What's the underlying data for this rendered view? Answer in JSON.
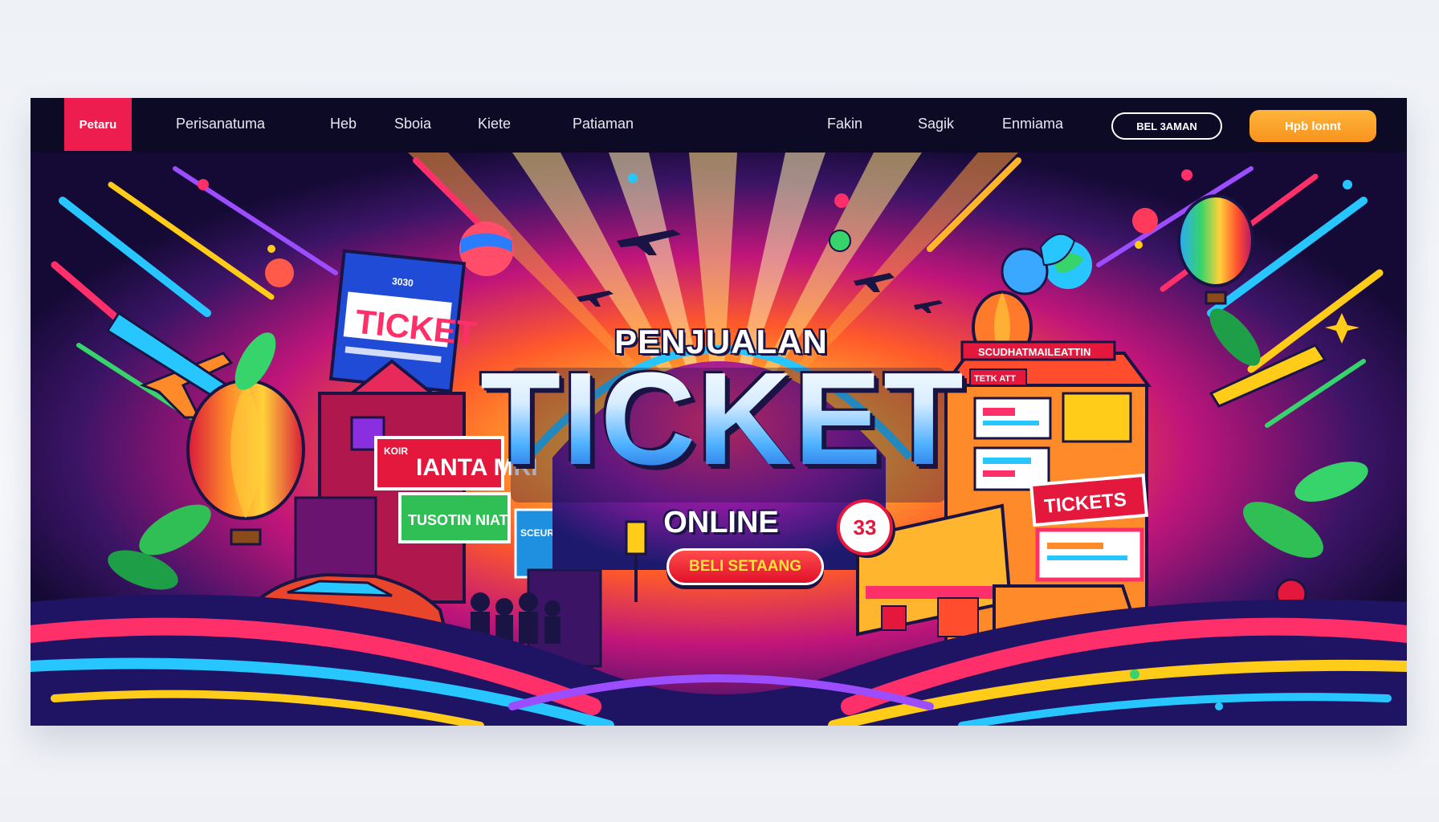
{
  "brand": {
    "logo_text": "Petaru"
  },
  "nav": {
    "items": [
      "Perisanatuma",
      "Heb",
      "Sboia",
      "Kiete",
      "Patiaman",
      "Fakin",
      "Sagik",
      "Enmiama"
    ],
    "outline_button": "BEL 3AMAN",
    "primary_button": "Hpb lonnt"
  },
  "hero": {
    "pre_title": "PENJUALAN",
    "title": "TICKET",
    "subtitle": "ONLINE",
    "badge": "33",
    "cta": "BELI SETAANG",
    "signs": {
      "left_billboard": "TICKET",
      "left_billboard_small": "3030",
      "left_red_sign": "IANTA MRI",
      "left_red_sign_small": "KOIR",
      "left_green_sign": "TUSOTIN NIAT",
      "left_blue_sign": "SCEURIN",
      "right_building_top": "SCUDHATMAILEATTIN",
      "right_building_top_left": "TETK ATT",
      "right_tickets_sign": "TICKETS"
    }
  },
  "colors": {
    "frame_bg": "#120a2e",
    "navbar_bg": "#0d0a26",
    "logo_bg": "#ee1d4f",
    "primary_button": "#f7931e",
    "cta_red": "#e0112b",
    "cta_text": "#ffe23a"
  }
}
